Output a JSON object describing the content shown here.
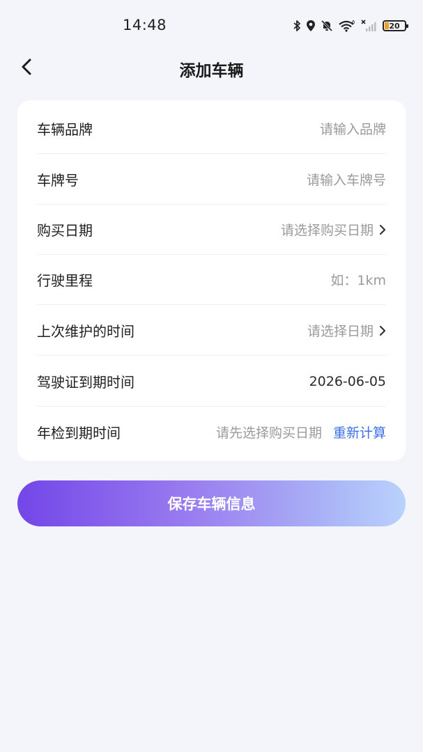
{
  "status_bar": {
    "time": "14:48",
    "battery": "20",
    "icons": [
      "bluetooth-icon",
      "location-icon",
      "bell-muted-icon",
      "wifi-icon",
      "signal-icon",
      "battery-icon"
    ],
    "battery_color": "#f0a020"
  },
  "header": {
    "title": "添加车辆",
    "back_icon": "chevron-left-icon"
  },
  "form": {
    "rows": [
      {
        "label": "车辆品牌",
        "placeholder": "请输入品牌",
        "type": "input"
      },
      {
        "label": "车牌号",
        "placeholder": "请输入车牌号",
        "type": "input"
      },
      {
        "label": "购买日期",
        "placeholder": "请选择购买日期",
        "type": "picker"
      },
      {
        "label": "行驶里程",
        "placeholder": "如：1km",
        "type": "input"
      },
      {
        "label": "上次维护的时间",
        "placeholder": "请选择日期",
        "type": "picker"
      },
      {
        "label": "驾驶证到期时间",
        "value": "2026-06-05",
        "type": "picker"
      },
      {
        "label": "年检到期时间",
        "placeholder": "请先选择购买日期",
        "action": "重新计算",
        "type": "computed"
      }
    ]
  },
  "save_button": {
    "label": "保存车辆信息"
  },
  "colors": {
    "background": "#f4f5fa",
    "link": "#3b6fe8",
    "button_gradient_start": "#7346e8",
    "button_gradient_end": "#b9d2fd"
  }
}
